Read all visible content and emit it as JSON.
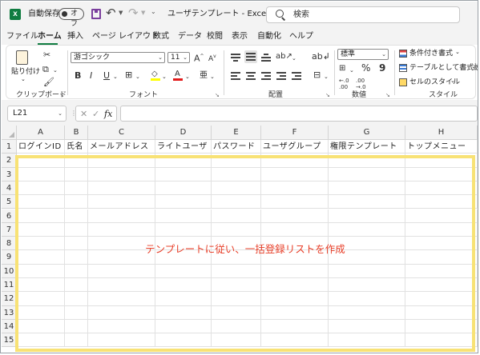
{
  "titlebar": {
    "app_icon_letter": "x",
    "autosave_label": "自動保存",
    "autosave_state": "オフ",
    "document_title": "ユーザテンプレート - Excel",
    "search_placeholder": "検索",
    "qat_more": "⌄"
  },
  "menu": {
    "tabs": [
      "ファイル",
      "ホーム",
      "挿入",
      "ページ レイアウト",
      "数式",
      "データ",
      "校閲",
      "表示",
      "自動化",
      "ヘルプ"
    ],
    "active_tab": "ホーム"
  },
  "ribbon": {
    "clipboard": {
      "label": "クリップボード",
      "paste": "貼り付け",
      "paste_dd": "⌄"
    },
    "font": {
      "label": "フォント",
      "font_name": "游ゴシック",
      "font_size": "11",
      "grow": "A",
      "shrink": "A",
      "bold": "B",
      "italic": "I",
      "underline": "U",
      "font_color_letter": "A",
      "phonetic": "亜"
    },
    "alignment": {
      "label": "配置"
    },
    "number": {
      "label": "数値",
      "format": "標準",
      "percent": "%",
      "comma": "9"
    },
    "styles": {
      "label": "スタイル",
      "conditional": "条件付き書式",
      "table": "テーブルとして書式設定",
      "cell_styles": "セルのスタイル"
    },
    "launcher": "↘"
  },
  "formula_bar": {
    "name_box": "L21",
    "cancel": "✕",
    "enter": "✓",
    "fx": "fx",
    "value": ""
  },
  "sheet": {
    "columns": [
      "A",
      "B",
      "C",
      "D",
      "E",
      "F",
      "G",
      "H"
    ],
    "rows": [
      "1",
      "2",
      "3",
      "4",
      "5",
      "6",
      "7",
      "8",
      "9",
      "10",
      "11",
      "12",
      "13",
      "14",
      "15"
    ],
    "header_row": [
      "ログインID",
      "氏名",
      "メールアドレス",
      "ライトユーザ",
      "パスワード",
      "ユーザグループ",
      "権限テンプレート",
      "トップメニュー"
    ]
  },
  "annotation": {
    "text": "テンプレートに従い、一括登録リストを作成",
    "color": "#e8402a",
    "highlight_color": "#f8e275"
  }
}
